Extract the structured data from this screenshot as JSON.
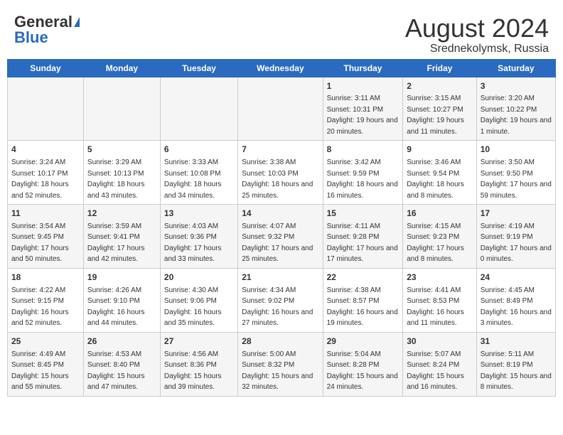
{
  "header": {
    "logo_general": "General",
    "logo_blue": "Blue",
    "calendar_title": "August 2024",
    "calendar_subtitle": "Srednekolymsk, Russia"
  },
  "weekdays": [
    "Sunday",
    "Monday",
    "Tuesday",
    "Wednesday",
    "Thursday",
    "Friday",
    "Saturday"
  ],
  "weeks": [
    [
      {
        "day": "",
        "sunrise": "",
        "sunset": "",
        "daylight": ""
      },
      {
        "day": "",
        "sunrise": "",
        "sunset": "",
        "daylight": ""
      },
      {
        "day": "",
        "sunrise": "",
        "sunset": "",
        "daylight": ""
      },
      {
        "day": "",
        "sunrise": "",
        "sunset": "",
        "daylight": ""
      },
      {
        "day": "1",
        "sunrise": "Sunrise: 3:11 AM",
        "sunset": "Sunset: 10:31 PM",
        "daylight": "Daylight: 19 hours and 20 minutes."
      },
      {
        "day": "2",
        "sunrise": "Sunrise: 3:15 AM",
        "sunset": "Sunset: 10:27 PM",
        "daylight": "Daylight: 19 hours and 11 minutes."
      },
      {
        "day": "3",
        "sunrise": "Sunrise: 3:20 AM",
        "sunset": "Sunset: 10:22 PM",
        "daylight": "Daylight: 19 hours and 1 minute."
      }
    ],
    [
      {
        "day": "4",
        "sunrise": "Sunrise: 3:24 AM",
        "sunset": "Sunset: 10:17 PM",
        "daylight": "Daylight: 18 hours and 52 minutes."
      },
      {
        "day": "5",
        "sunrise": "Sunrise: 3:29 AM",
        "sunset": "Sunset: 10:13 PM",
        "daylight": "Daylight: 18 hours and 43 minutes."
      },
      {
        "day": "6",
        "sunrise": "Sunrise: 3:33 AM",
        "sunset": "Sunset: 10:08 PM",
        "daylight": "Daylight: 18 hours and 34 minutes."
      },
      {
        "day": "7",
        "sunrise": "Sunrise: 3:38 AM",
        "sunset": "Sunset: 10:03 PM",
        "daylight": "Daylight: 18 hours and 25 minutes."
      },
      {
        "day": "8",
        "sunrise": "Sunrise: 3:42 AM",
        "sunset": "Sunset: 9:59 PM",
        "daylight": "Daylight: 18 hours and 16 minutes."
      },
      {
        "day": "9",
        "sunrise": "Sunrise: 3:46 AM",
        "sunset": "Sunset: 9:54 PM",
        "daylight": "Daylight: 18 hours and 8 minutes."
      },
      {
        "day": "10",
        "sunrise": "Sunrise: 3:50 AM",
        "sunset": "Sunset: 9:50 PM",
        "daylight": "Daylight: 17 hours and 59 minutes."
      }
    ],
    [
      {
        "day": "11",
        "sunrise": "Sunrise: 3:54 AM",
        "sunset": "Sunset: 9:45 PM",
        "daylight": "Daylight: 17 hours and 50 minutes."
      },
      {
        "day": "12",
        "sunrise": "Sunrise: 3:59 AM",
        "sunset": "Sunset: 9:41 PM",
        "daylight": "Daylight: 17 hours and 42 minutes."
      },
      {
        "day": "13",
        "sunrise": "Sunrise: 4:03 AM",
        "sunset": "Sunset: 9:36 PM",
        "daylight": "Daylight: 17 hours and 33 minutes."
      },
      {
        "day": "14",
        "sunrise": "Sunrise: 4:07 AM",
        "sunset": "Sunset: 9:32 PM",
        "daylight": "Daylight: 17 hours and 25 minutes."
      },
      {
        "day": "15",
        "sunrise": "Sunrise: 4:11 AM",
        "sunset": "Sunset: 9:28 PM",
        "daylight": "Daylight: 17 hours and 17 minutes."
      },
      {
        "day": "16",
        "sunrise": "Sunrise: 4:15 AM",
        "sunset": "Sunset: 9:23 PM",
        "daylight": "Daylight: 17 hours and 8 minutes."
      },
      {
        "day": "17",
        "sunrise": "Sunrise: 4:19 AM",
        "sunset": "Sunset: 9:19 PM",
        "daylight": "Daylight: 17 hours and 0 minutes."
      }
    ],
    [
      {
        "day": "18",
        "sunrise": "Sunrise: 4:22 AM",
        "sunset": "Sunset: 9:15 PM",
        "daylight": "Daylight: 16 hours and 52 minutes."
      },
      {
        "day": "19",
        "sunrise": "Sunrise: 4:26 AM",
        "sunset": "Sunset: 9:10 PM",
        "daylight": "Daylight: 16 hours and 44 minutes."
      },
      {
        "day": "20",
        "sunrise": "Sunrise: 4:30 AM",
        "sunset": "Sunset: 9:06 PM",
        "daylight": "Daylight: 16 hours and 35 minutes."
      },
      {
        "day": "21",
        "sunrise": "Sunrise: 4:34 AM",
        "sunset": "Sunset: 9:02 PM",
        "daylight": "Daylight: 16 hours and 27 minutes."
      },
      {
        "day": "22",
        "sunrise": "Sunrise: 4:38 AM",
        "sunset": "Sunset: 8:57 PM",
        "daylight": "Daylight: 16 hours and 19 minutes."
      },
      {
        "day": "23",
        "sunrise": "Sunrise: 4:41 AM",
        "sunset": "Sunset: 8:53 PM",
        "daylight": "Daylight: 16 hours and 11 minutes."
      },
      {
        "day": "24",
        "sunrise": "Sunrise: 4:45 AM",
        "sunset": "Sunset: 8:49 PM",
        "daylight": "Daylight: 16 hours and 3 minutes."
      }
    ],
    [
      {
        "day": "25",
        "sunrise": "Sunrise: 4:49 AM",
        "sunset": "Sunset: 8:45 PM",
        "daylight": "Daylight: 15 hours and 55 minutes."
      },
      {
        "day": "26",
        "sunrise": "Sunrise: 4:53 AM",
        "sunset": "Sunset: 8:40 PM",
        "daylight": "Daylight: 15 hours and 47 minutes."
      },
      {
        "day": "27",
        "sunrise": "Sunrise: 4:56 AM",
        "sunset": "Sunset: 8:36 PM",
        "daylight": "Daylight: 15 hours and 39 minutes."
      },
      {
        "day": "28",
        "sunrise": "Sunrise: 5:00 AM",
        "sunset": "Sunset: 8:32 PM",
        "daylight": "Daylight: 15 hours and 32 minutes."
      },
      {
        "day": "29",
        "sunrise": "Sunrise: 5:04 AM",
        "sunset": "Sunset: 8:28 PM",
        "daylight": "Daylight: 15 hours and 24 minutes."
      },
      {
        "day": "30",
        "sunrise": "Sunrise: 5:07 AM",
        "sunset": "Sunset: 8:24 PM",
        "daylight": "Daylight: 15 hours and 16 minutes."
      },
      {
        "day": "31",
        "sunrise": "Sunrise: 5:11 AM",
        "sunset": "Sunset: 8:19 PM",
        "daylight": "Daylight: 15 hours and 8 minutes."
      }
    ]
  ]
}
